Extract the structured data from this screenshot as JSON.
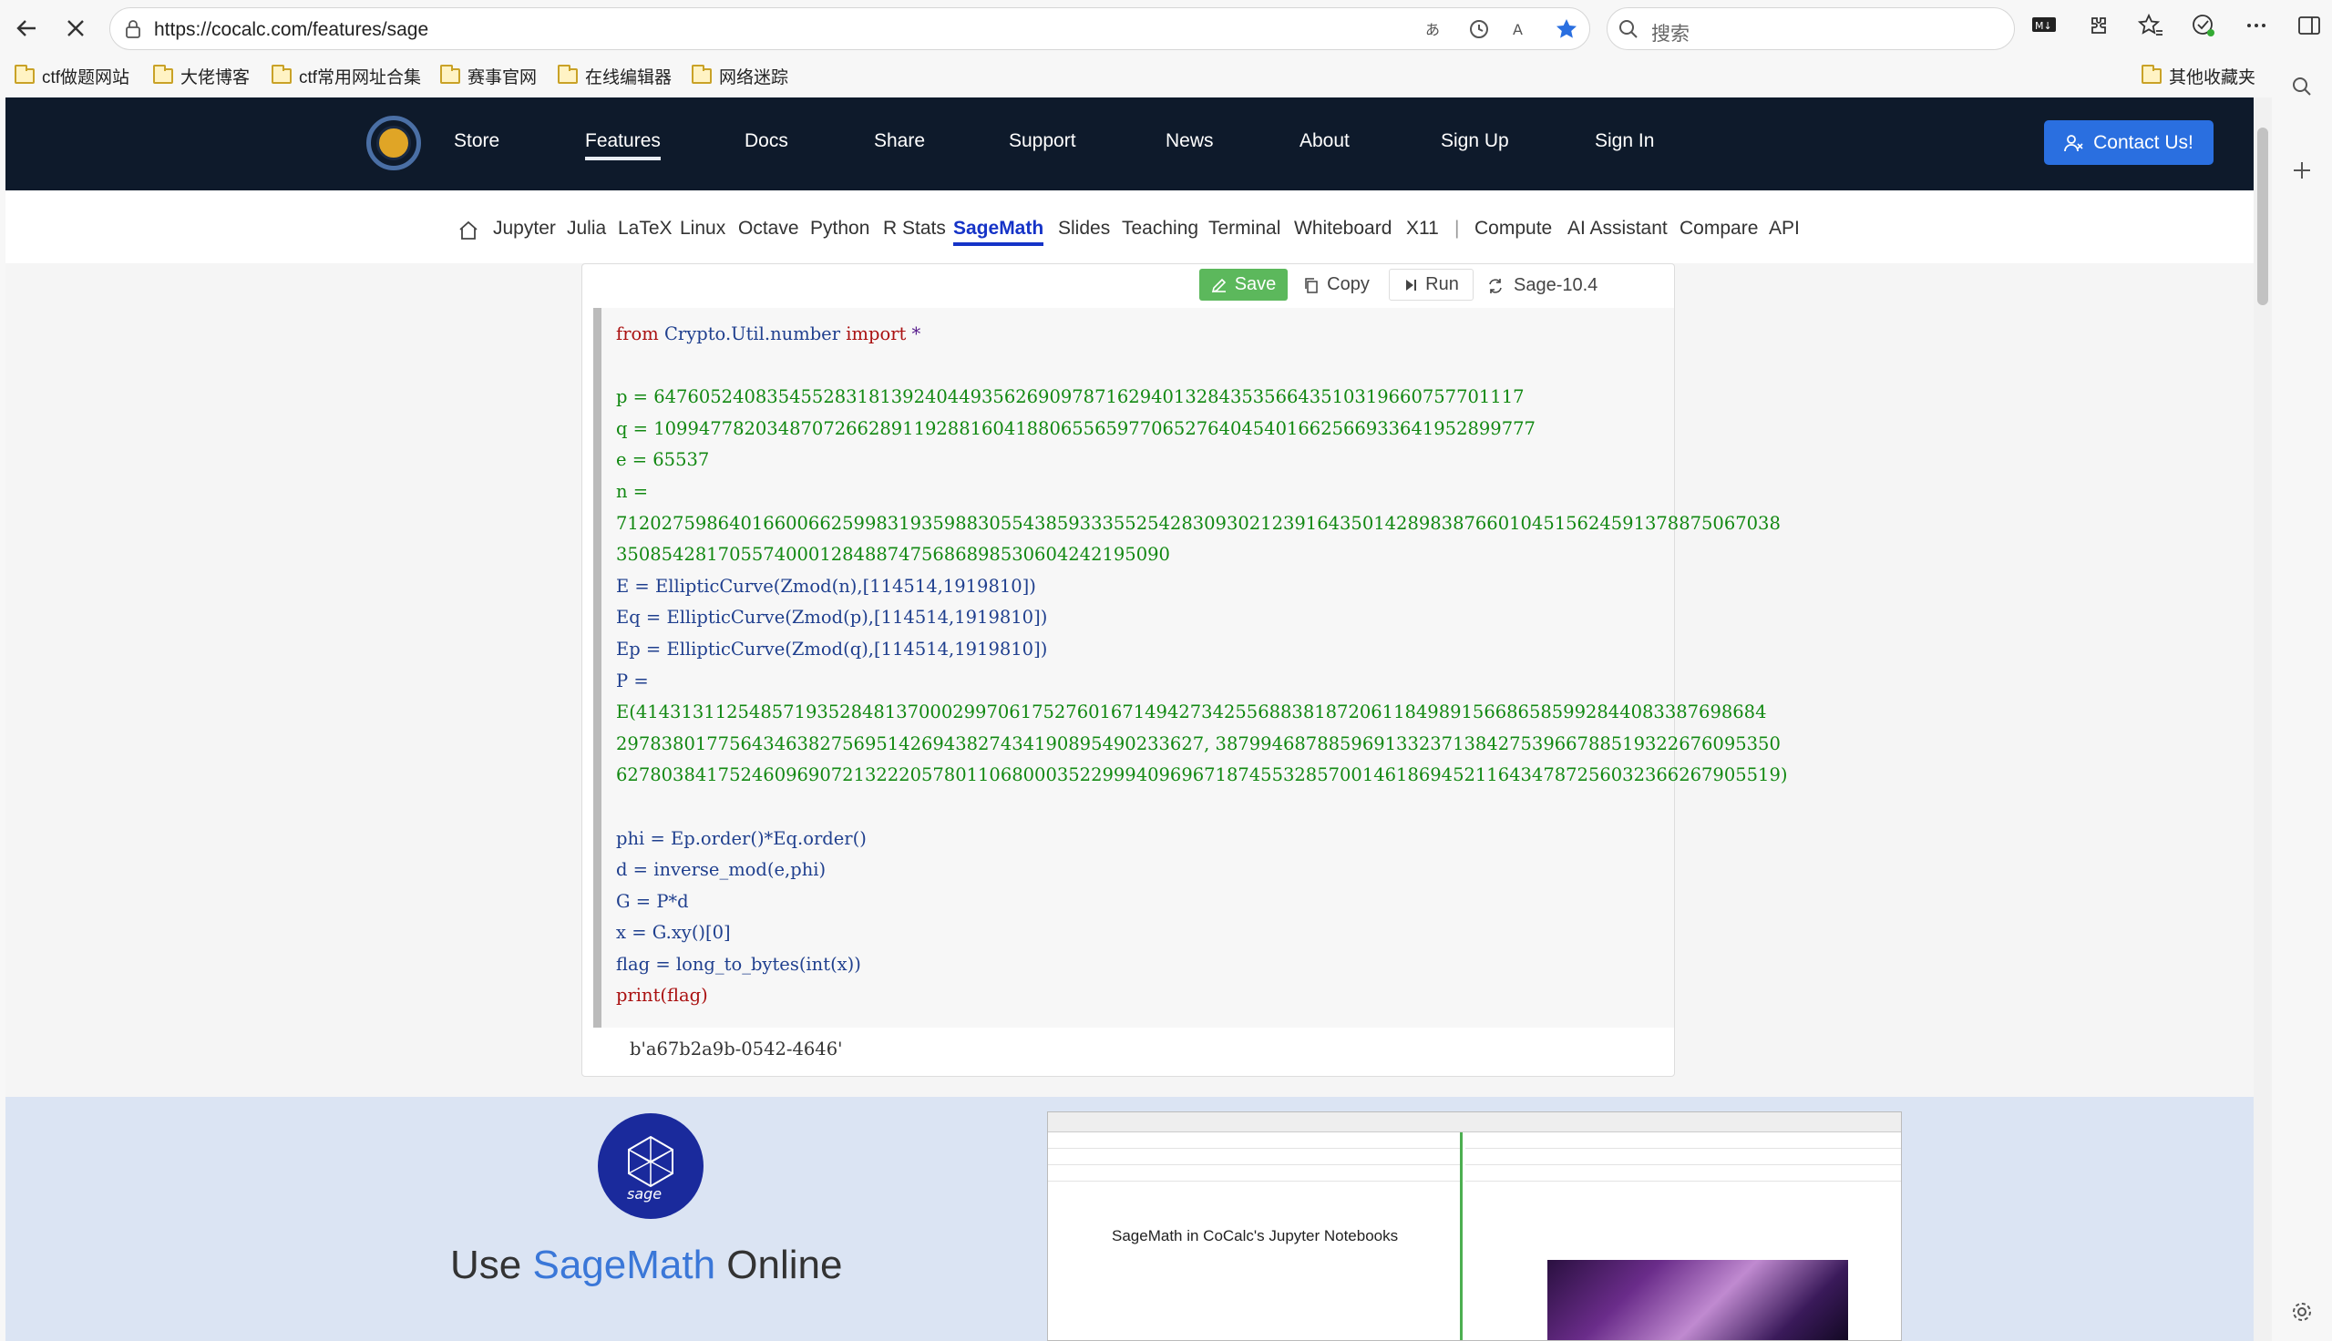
{
  "browser": {
    "url": "https://cocalc.com/features/sage",
    "search_placeholder": "搜索",
    "bookmarks": [
      "ctf做题网站",
      "大佬博客",
      "ctf常用网址合集",
      "赛事官网",
      "在线编辑器",
      "网络迷踪"
    ],
    "other_bookmarks": "其他收藏夹"
  },
  "nav": {
    "items": [
      "Store",
      "Features",
      "Docs",
      "Share",
      "Support",
      "News",
      "About",
      "Sign Up",
      "Sign In"
    ],
    "active": "Features",
    "contact": "Contact Us!"
  },
  "subnav": {
    "items": [
      "Jupyter",
      "Julia",
      "LaTeX",
      "Linux",
      "Octave",
      "Python",
      "R Stats",
      "SageMath",
      "Slides",
      "Teaching",
      "Terminal",
      "Whiteboard",
      "X11"
    ],
    "separator": "|",
    "items2": [
      "Compute",
      "AI Assistant",
      "Compare",
      "API"
    ],
    "active": "SageMath"
  },
  "toolbar": {
    "save": "Save",
    "copy": "Copy",
    "run": "Run",
    "kernel": "Sage-10.4"
  },
  "code": {
    "line1": [
      "from",
      " Crypto.Util.number ",
      "import",
      " *"
    ],
    "p": "p = 64760524083545528318139240449356269097871629401328435356643510319660757701117",
    "q": "q = 109947782034870726628911928816041880655659770652764045401662566933641952899777",
    "e": "e = 65537",
    "n1": "n =",
    "n2": "7120275986401660066259983193598830554385933355254283093021239164350142898387660104515624591378875067038",
    "n3": "3508542817055740001284887475686898530604242195090",
    "E": "E = EllipticCurve(Zmod(n),[114514,1919810])",
    "Eq": "Eq = EllipticCurve(Zmod(p),[114514,1919810])",
    "Ep": "Ep = EllipticCurve(Zmod(q),[114514,1919810])",
    "P1": "P =",
    "P2": "E(4143131125485719352848137000299706175276016714942734255688381872061184989156686585992844083387698684",
    "P3": "2978380177564346382756951426943827434190895490233627, 38799468788596913323713842753966788519322676095350",
    "P4": "627803841752460969072132220578011068000352299940969671874553285700146186945211643478725603236626790551",
    "P4end": "9)",
    "phi": "phi = Ep.order()*Eq.order()",
    "d": "d = inverse_mod(e,phi)",
    "G": "G = P*d",
    "x": "x = G.xy()[0]",
    "flag": "flag = long_to_bytes(int(x))",
    "print": "print(flag)"
  },
  "output": "b'a67b2a9b-0542-4646'",
  "lower": {
    "title_pre": "Use ",
    "title_hl": "SageMath",
    "title_post": " Online",
    "screenshot_caption": "SageMath in CoCalc's Jupyter Notebooks"
  }
}
